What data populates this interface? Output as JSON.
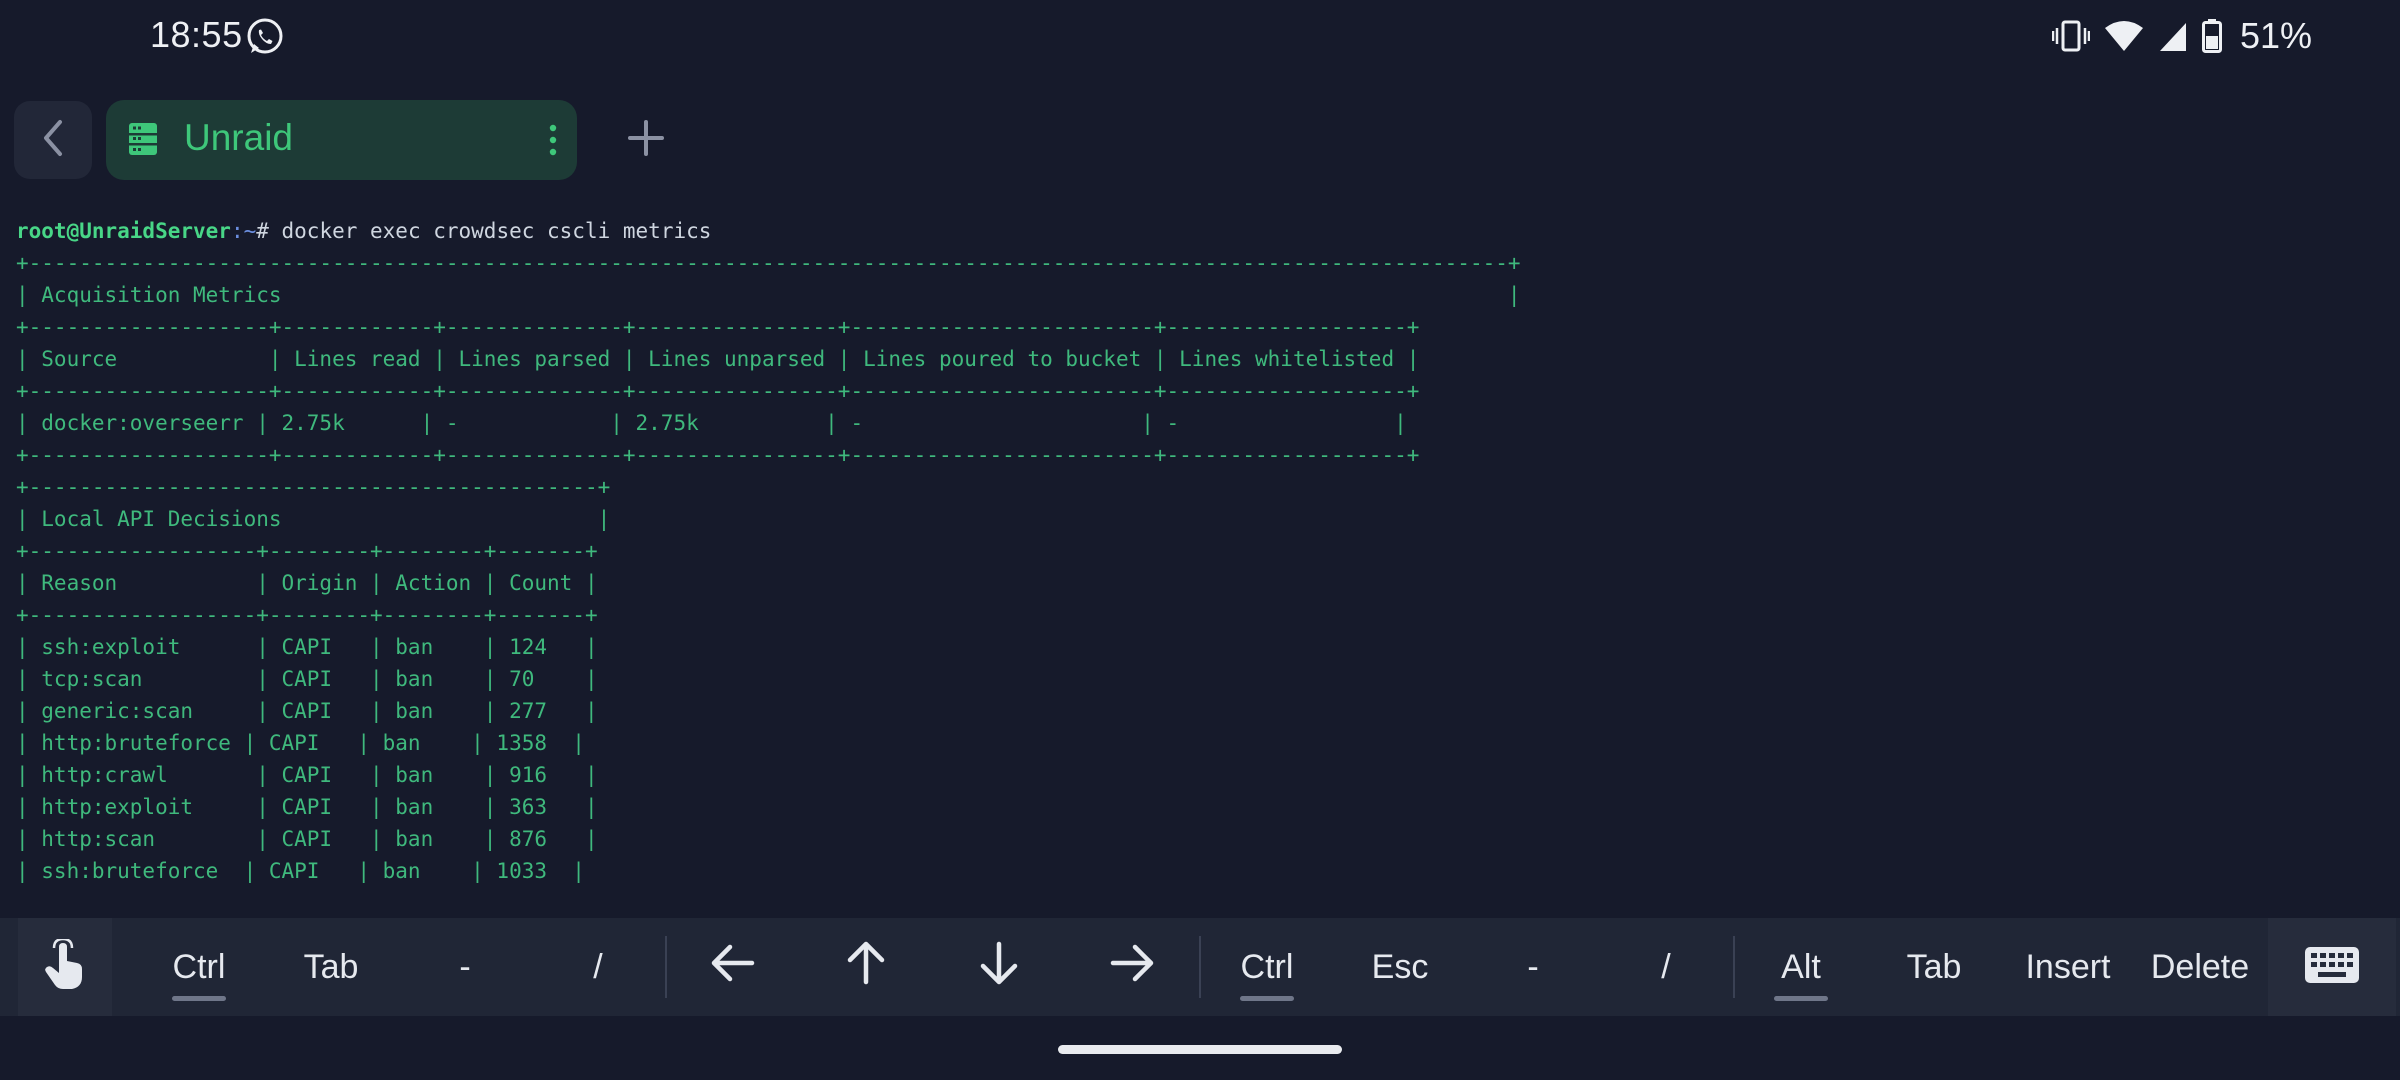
{
  "status_bar": {
    "time": "18:55",
    "notification_icons": [
      "whatsapp-icon"
    ],
    "system_icons": [
      "vibrate-icon",
      "wifi-icon",
      "cell-signal-icon",
      "battery-icon"
    ],
    "battery_percent": "51%"
  },
  "tabs": {
    "back_icon": "chevron-left-icon",
    "active_tab": {
      "label": "Unraid",
      "icon": "server-icon",
      "menu_icon": "more-vertical-icon"
    },
    "add_icon": "plus-icon"
  },
  "terminal": {
    "prompt_user_host": "root@UnraidServer",
    "prompt_path": ":~",
    "prompt_command": "# docker exec crowdsec cscli metrics",
    "lines": [
      "+---------------------------------------------------------------------------------------------------------------------+",
      "| Acquisition Metrics                                                                                                 |",
      "+-------------------+------------+--------------+----------------+------------------------+-------------------+",
      "| Source            | Lines read | Lines parsed | Lines unparsed | Lines poured to bucket | Lines whitelisted |",
      "+-------------------+------------+--------------+----------------+------------------------+-------------------+",
      "| docker:overseerr | 2.75k      | -            | 2.75k          | -                      | -                 |",
      "+-------------------+------------+--------------+----------------+------------------------+-------------------+",
      "+---------------------------------------------+",
      "| Local API Decisions                         |",
      "+------------------+--------+--------+-------+",
      "| Reason           | Origin | Action | Count |",
      "+------------------+--------+--------+-------+",
      "| ssh:exploit      | CAPI   | ban    | 124   |",
      "| tcp:scan         | CAPI   | ban    | 70    |",
      "| generic:scan     | CAPI   | ban    | 277   |",
      "| http:bruteforce | CAPI   | ban    | 1358  |",
      "| http:crawl       | CAPI   | ban    | 916   |",
      "| http:exploit     | CAPI   | ban    | 363   |",
      "| http:scan        | CAPI   | ban    | 876   |",
      "| ssh:bruteforce  | CAPI   | ban    | 1033  |"
    ]
  },
  "extra_keys": {
    "touch_icon": "touch-hand-icon",
    "keyboard_icon": "keyboard-icon",
    "keys": [
      {
        "label": "Ctrl",
        "underline": true
      },
      {
        "label": "Tab"
      },
      {
        "label": "-"
      },
      {
        "label": "/"
      },
      {
        "icon": "arrow-left-icon"
      },
      {
        "icon": "arrow-up-icon"
      },
      {
        "icon": "arrow-down-icon"
      },
      {
        "icon": "arrow-right-icon"
      },
      {
        "label": "Ctrl",
        "underline": true
      },
      {
        "label": "Esc"
      },
      {
        "label": "-"
      },
      {
        "label": "/"
      },
      {
        "label": "Alt",
        "underline": true
      },
      {
        "label": "Tab"
      },
      {
        "label": "Insert"
      },
      {
        "label": "Delete"
      }
    ]
  },
  "colors": {
    "background": "#161a2b",
    "terminal_text": "#3fb97d",
    "accent_green": "#3ec77a",
    "tab_background": "#1d3b36",
    "keybar_background": "#202636"
  }
}
